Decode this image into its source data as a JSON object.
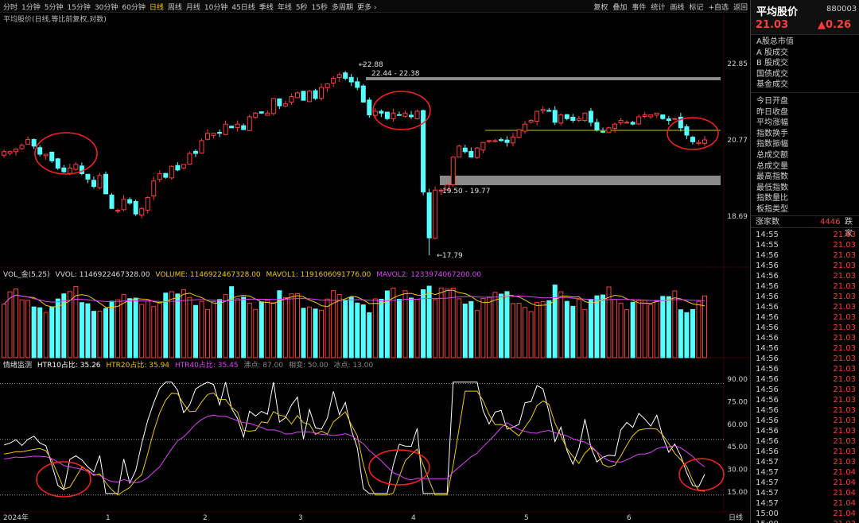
{
  "toolbar": {
    "periods": [
      "分时",
      "1分钟",
      "5分钟",
      "15分钟",
      "30分钟",
      "60分钟",
      "日线",
      "周线",
      "月线",
      "10分钟",
      "45日线",
      "季线",
      "年线",
      "5秒",
      "15秒",
      "多周期",
      "更多 ›"
    ],
    "active_period": "日线",
    "tools": [
      "复权",
      "叠加",
      "事件",
      "统计",
      "画线",
      "标记",
      "+自选",
      "返回"
    ]
  },
  "chart_title": "平均股价(日线,等比前复权,对数)",
  "price_panel": {
    "axis_labels": [
      "22.85",
      "20.77",
      "18.69"
    ],
    "annotations": {
      "high": "22.88",
      "high_range": "22.44 - 22.38",
      "low_range": "19.50 - 19.77",
      "low": "17.79"
    }
  },
  "volume_legend": {
    "name": "VOL_金(5,25)",
    "vvol": "VVOL: 1146922467328.00",
    "volume": "VOLUME: 1146922467328.00",
    "mavol1": "MAVOL1: 1191606091776.00",
    "mavol2": "MAVOL2: 1233974067200.00"
  },
  "emotion_legend": {
    "name": "情绪监测",
    "htr10": "HTR10占比: 35.26",
    "htr20": "HTR20占比: 35.94",
    "htr40": "HTR40占比: 35.45",
    "hot": "沸点: 87.00",
    "change": "相变: 50.00",
    "ice": "冰点: 13.00"
  },
  "emotion_axis": [
    "90.00",
    "75.00",
    "60.00",
    "45.00",
    "30.00",
    "15.00"
  ],
  "x_axis": {
    "labels": [
      "2024年",
      "1",
      "2",
      "3",
      "4",
      "5",
      "6"
    ],
    "period_label": "日线"
  },
  "right_panel": {
    "name": "平均股价",
    "code": "880003",
    "price": "21.03",
    "change": "▲0.26",
    "menu": [
      "A股总市值",
      "A 股成交",
      "B 股成交",
      "国债成交",
      "基金成交",
      "今日开盘",
      "昨日收盘",
      "平均涨幅",
      "指数换手",
      "指数振幅",
      "总成交额",
      "总成交量",
      "最高指数",
      "最低指数",
      "指数量比",
      "板指类型"
    ],
    "stats_label": "涨家数",
    "stats_up": "4446",
    "stats_down_label": "跌家",
    "ticks": [
      {
        "time": "14:55",
        "price": "21.03"
      },
      {
        "time": "14:55",
        "price": "21.03"
      },
      {
        "time": "14:56",
        "price": "21.03"
      },
      {
        "time": "14:56",
        "price": "21.03"
      },
      {
        "time": "14:56",
        "price": "21.03"
      },
      {
        "time": "14:56",
        "price": "21.03"
      },
      {
        "time": "14:56",
        "price": "21.03"
      },
      {
        "time": "14:56",
        "price": "21.03"
      },
      {
        "time": "14:56",
        "price": "21.03"
      },
      {
        "time": "14:56",
        "price": "21.03"
      },
      {
        "time": "14:56",
        "price": "21.03"
      },
      {
        "time": "14:56",
        "price": "21.03"
      },
      {
        "time": "14:56",
        "price": "21.03"
      },
      {
        "time": "14:56",
        "price": "21.03"
      },
      {
        "time": "14:56",
        "price": "21.03"
      },
      {
        "time": "14:56",
        "price": "21.03"
      },
      {
        "time": "14:56",
        "price": "21.03"
      },
      {
        "time": "14:56",
        "price": "21.03"
      },
      {
        "time": "14:56",
        "price": "21.03"
      },
      {
        "time": "14:56",
        "price": "21.03"
      },
      {
        "time": "14:56",
        "price": "21.03"
      },
      {
        "time": "14:56",
        "price": "21.03"
      },
      {
        "time": "14:57",
        "price": "21.03"
      },
      {
        "time": "14:57",
        "price": "21.04"
      },
      {
        "time": "14:57",
        "price": "21.04"
      },
      {
        "time": "14:57",
        "price": "21.04"
      },
      {
        "time": "14:57",
        "price": "21.04"
      },
      {
        "time": "15:00",
        "price": "21.04"
      },
      {
        "time": "15:00",
        "price": "21.03"
      }
    ]
  },
  "colors": {
    "up": "#ff3b3b",
    "down": "#54ffff",
    "ma1": "#f0c800",
    "ma2": "#e040fb",
    "line_white": "#ffffff",
    "circle": "#ff2020",
    "support_line": "#c8c800",
    "zone_grey": "#888888"
  },
  "chart_data": {
    "type": "candlestick",
    "series_price": [
      20.45,
      20.45,
      20.52,
      20.62,
      20.78,
      20.6,
      20.38,
      20.38,
      20.2,
      20.0,
      19.9,
      20.0,
      20.1,
      19.85,
      19.7,
      19.5,
      19.8,
      19.3,
      18.9,
      18.85,
      19.15,
      19.05,
      18.75,
      18.9,
      19.2,
      19.65,
      19.85,
      19.75,
      20.05,
      19.95,
      20.1,
      20.4,
      20.4,
      20.75,
      20.95,
      20.95,
      20.95,
      21.2,
      21.1,
      21.2,
      21.05,
      21.4,
      21.5,
      21.5,
      21.5,
      21.9,
      21.7,
      21.75,
      21.95,
      22.05,
      21.85,
      22.1,
      21.9,
      22.2,
      22.3,
      22.45,
      22.55,
      22.45,
      22.35,
      22.2,
      21.8,
      21.45,
      21.55,
      21.5,
      21.35,
      21.5,
      21.45,
      21.5,
      21.4,
      21.55,
      19.35,
      18.1,
      19.4,
      19.4,
      19.55,
      20.3,
      20.6,
      20.45,
      20.3,
      20.55,
      20.7,
      20.75,
      20.75,
      20.75,
      20.7,
      20.85,
      21.05,
      21.2,
      21.3,
      21.55,
      21.6,
      21.55,
      21.25,
      21.45,
      21.35,
      21.3,
      21.35,
      21.5,
      21.25,
      21.05,
      21.0,
      21.1,
      21.2,
      21.3,
      21.25,
      21.2,
      21.4,
      21.45,
      21.45,
      21.5,
      21.35,
      21.3,
      21.35,
      21.1,
      20.9,
      20.72,
      20.7,
      20.77
    ]
  }
}
